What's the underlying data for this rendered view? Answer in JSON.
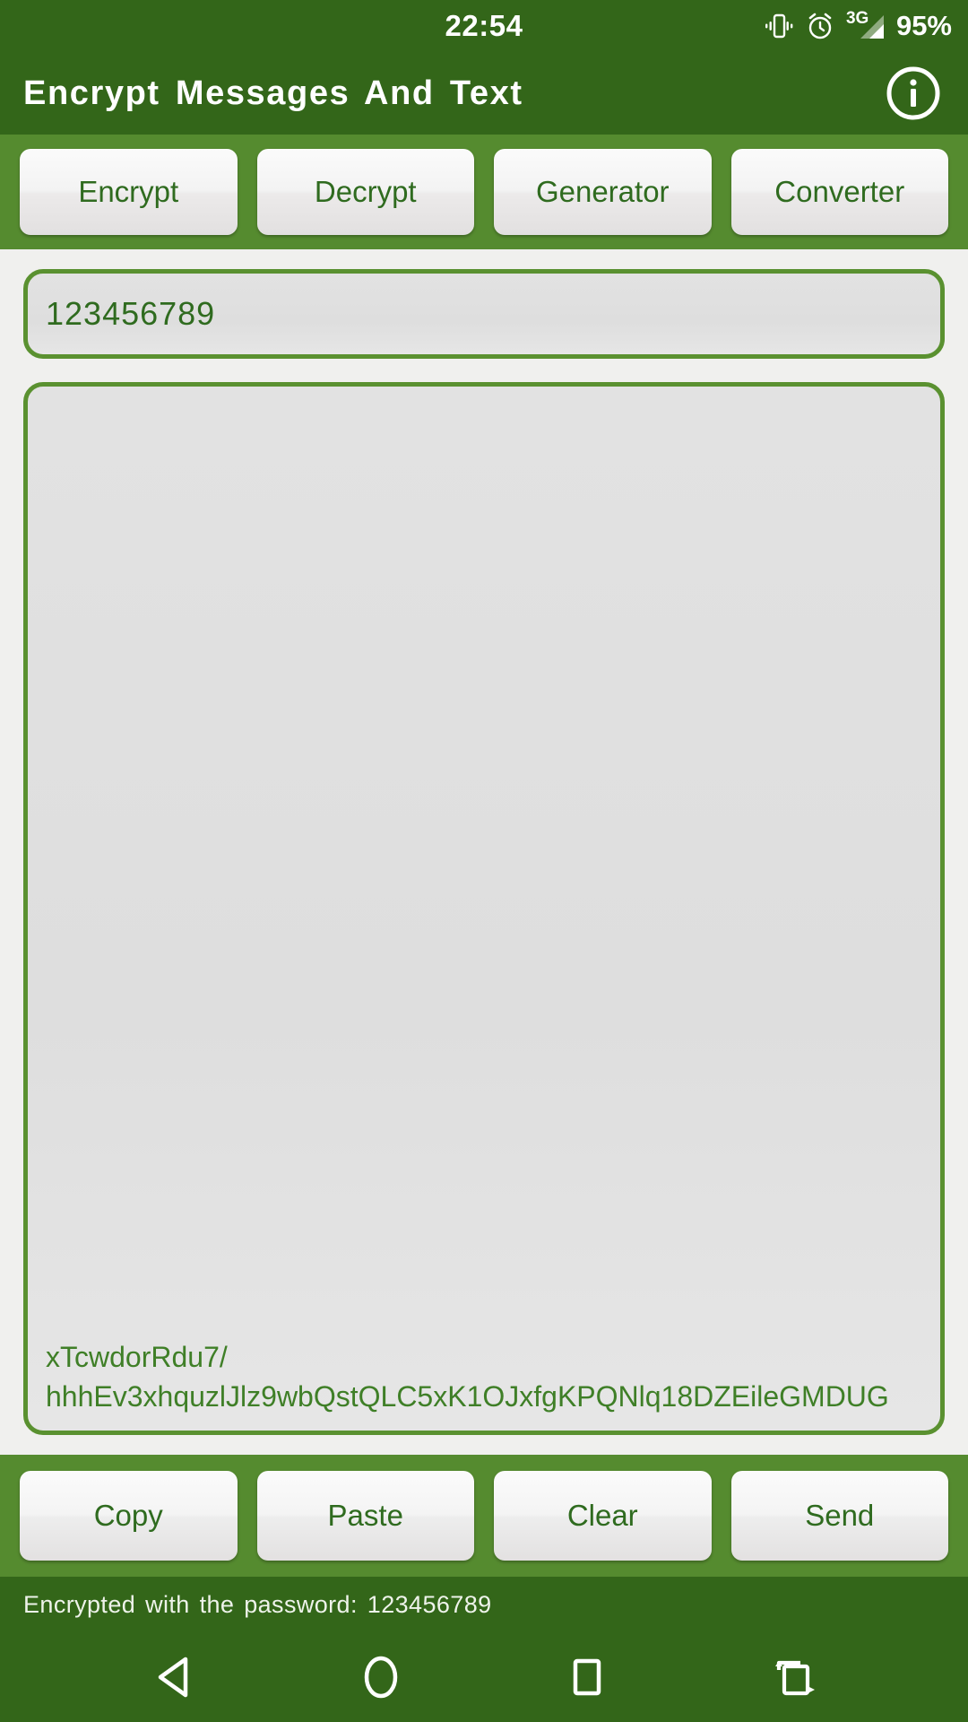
{
  "status_bar": {
    "clock": "22:54",
    "network_type": "3G",
    "battery": "95%",
    "icons": [
      "vibrate-icon",
      "alarm-icon",
      "signal-icon"
    ]
  },
  "app_bar": {
    "title": "Encrypt Messages And Text",
    "info_icon": "info-icon"
  },
  "tabs": [
    {
      "label": "Encrypt"
    },
    {
      "label": "Decrypt"
    },
    {
      "label": "Generator"
    },
    {
      "label": "Converter"
    }
  ],
  "main": {
    "password_field": {
      "value": "123456789",
      "placeholder": "Password"
    },
    "message_field": {
      "value": "xTcwdorRdu7/\nhhhEv3xhquzlJlz9wbQstQLC5xK1OJxfgKPQNlq18DZEileGMDUG",
      "placeholder": ""
    }
  },
  "actions": [
    {
      "label": "Copy"
    },
    {
      "label": "Paste"
    },
    {
      "label": "Clear"
    },
    {
      "label": "Send"
    }
  ],
  "status_line": {
    "text": "Encrypted with the password: 123456789"
  },
  "nav_bar": {
    "back": "back-triangle-icon",
    "home": "home-circle-icon",
    "recents": "recents-square-icon",
    "rotate": "rotate-screen-icon"
  },
  "colors": {
    "header_green": "#336619",
    "accent_green": "#558B2F",
    "border_green": "#5a9130",
    "text_green": "#2f6b1f",
    "cipher_green": "#3f7f27",
    "page_bg": "#f0f0ee",
    "field_bg": "#e0e0e0",
    "button_bg": "#f4f4f4"
  }
}
